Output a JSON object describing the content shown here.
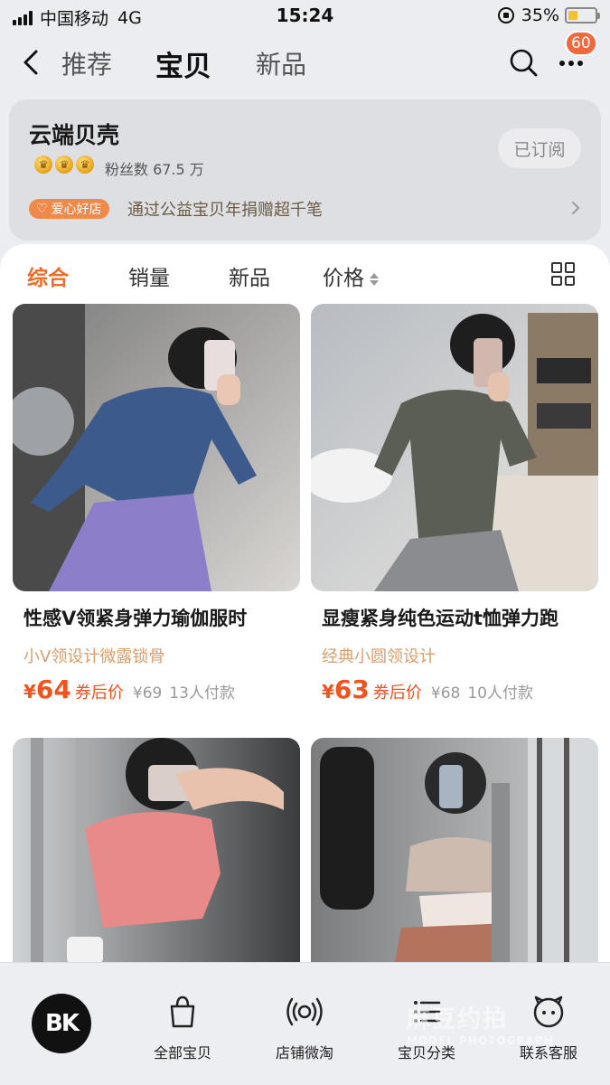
{
  "status": {
    "carrier": "中国移动",
    "network": "4G",
    "time": "15:24",
    "battery_pct": "35%",
    "battery_level": 0.35,
    "battery_color": "#f2c230"
  },
  "nav": {
    "tabs": [
      {
        "label": "推荐",
        "active": false
      },
      {
        "label": "宝贝",
        "active": true
      },
      {
        "label": "新品",
        "active": false
      }
    ],
    "message_count": "60",
    "icons": {
      "back": "chevron-left-icon",
      "search": "search-icon",
      "more": "more-dots-icon"
    }
  },
  "shop": {
    "name": "云端贝壳",
    "fans": "粉丝数 67.5 万",
    "crown_count": 3,
    "subscribe_label": "已订阅",
    "charity_badge": "爱心好店",
    "charity_text": "通过公益宝贝年捐赠超千笔"
  },
  "filters": {
    "items": [
      "综合",
      "销量",
      "新品",
      "价格"
    ],
    "active": "综合",
    "accent_color": "#f26b25"
  },
  "products": [
    {
      "title": "性感Ⅴ领紧身弹力瑜伽服时",
      "subtitle": "小Ⅴ领设计微露锁骨",
      "currency": "¥",
      "price": "64",
      "price_tag": "券后价",
      "original_price": "¥69",
      "paid": "13人付款"
    },
    {
      "title": "显瘦紧身纯色运动t恤弹力跑",
      "subtitle": "经典小圆领设计",
      "currency": "¥",
      "price": "63",
      "price_tag": "券后价",
      "original_price": "¥68",
      "paid": "10人付款"
    },
    {
      "title": "",
      "subtitle": ""
    },
    {
      "title": "",
      "subtitle": ""
    }
  ],
  "tabbar": {
    "logo_text": "BK",
    "items": [
      {
        "label": "全部宝贝",
        "icon": "shopping-bag-icon"
      },
      {
        "label": "店铺微淘",
        "icon": "broadcast-icon"
      },
      {
        "label": "宝贝分类",
        "icon": "list-icon"
      },
      {
        "label": "联系客服",
        "icon": "chat-face-icon"
      }
    ],
    "watermark": "麻豆约拍",
    "watermark_sub": "MODEL PHOTOGRAPH"
  }
}
